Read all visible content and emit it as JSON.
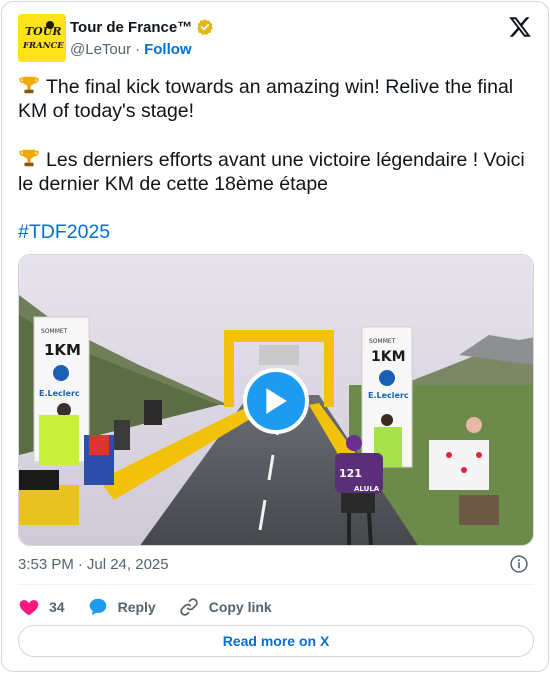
{
  "author": {
    "display_name": "Tour de France™",
    "handle": "@LeTour",
    "separator": "·",
    "follow_label": "Follow",
    "avatar_text_top": "TOUR",
    "avatar_text_bottom": "FRANCE"
  },
  "tweet": {
    "line1": "The final kick towards an amazing win! Relive the final KM of today's stage!",
    "line2": "Les derniers efforts avant une victoire légendaire ! Voici le dernier KM de cette 18ème étape",
    "hashtag": "#TDF2025"
  },
  "media": {
    "sign_left_km": "1KM",
    "sign_right_km": "1KM",
    "sign_brand": "E.Leclerc",
    "summit_label": "SOMMET",
    "rider_number": "121",
    "rider_team": "ALULA"
  },
  "meta": {
    "time": "3:53 PM",
    "separator": "·",
    "date": "Jul 24, 2025"
  },
  "actions": {
    "like_count": "34",
    "reply_label": "Reply",
    "copy_label": "Copy link"
  },
  "footer": {
    "read_more": "Read more on X"
  },
  "colors": {
    "accent": "#006fd6",
    "play": "#1d9bf0",
    "like": "#f91880",
    "avatar_bg": "#ffe21a"
  }
}
